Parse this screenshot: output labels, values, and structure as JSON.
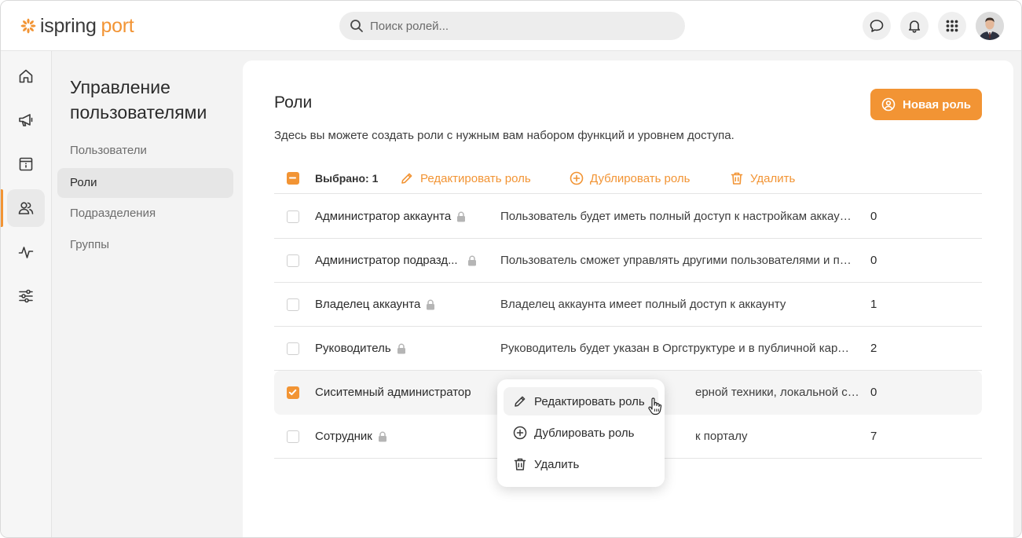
{
  "app": {
    "logo_part1": "ispring",
    "logo_part2": "port",
    "accent_color": "#f29434"
  },
  "header": {
    "search_placeholder": "Поиск ролей...",
    "icons": [
      "chat-icon",
      "bell-icon",
      "apps-grid-icon",
      "user-avatar"
    ]
  },
  "rail": {
    "items": [
      "home-icon",
      "megaphone-icon",
      "info-board-icon",
      "users-icon",
      "activity-icon",
      "settings-sliders-icon"
    ],
    "active_index": 3
  },
  "subnav": {
    "title": "Управление пользователями",
    "items": [
      {
        "label": "Пользователи"
      },
      {
        "label": "Роли"
      },
      {
        "label": "Подразделения"
      },
      {
        "label": "Группы"
      }
    ],
    "active_index": 1
  },
  "main": {
    "title": "Роли",
    "description": "Здесь вы можете создать роли с нужным вам набором функций и уровнем доступа.",
    "new_role_label": "Новая роль",
    "toolbar": {
      "selected_label": "Выбрано: 1",
      "edit_label": "Редактировать роль",
      "duplicate_label": "Дублировать роль",
      "delete_label": "Удалить"
    },
    "rows": [
      {
        "name": "Администратор аккаунта",
        "locked": true,
        "description": "Пользователь будет иметь полный доступ к настройкам аккаунта",
        "count": "0",
        "checked": false
      },
      {
        "name": "Администратор подразд...",
        "locked": true,
        "description": "Пользователь сможет управлять другими пользователями и подразделениями",
        "count": "0",
        "checked": false
      },
      {
        "name": "Владелец аккаунта",
        "locked": true,
        "description": "Владелец аккаунта имеет полный доступ к аккаунту",
        "count": "1",
        "checked": false
      },
      {
        "name": "Руководитель",
        "locked": true,
        "description": "Руководитель будет указан в Оргструктуре и в публичной карточке",
        "count": "2",
        "checked": false
      },
      {
        "name": "Сиситемный администратор",
        "locked": false,
        "description": "ерной техники, локальной сети, ...",
        "count": "0",
        "checked": true
      },
      {
        "name": "Сотрудник",
        "locked": true,
        "description": "к порталу",
        "count": "7",
        "checked": false
      }
    ],
    "context_menu": {
      "items": [
        {
          "label": "Редактировать роль",
          "icon": "pencil-icon"
        },
        {
          "label": "Дублировать роль",
          "icon": "plus-circle-icon"
        },
        {
          "label": "Удалить",
          "icon": "trash-icon"
        }
      ],
      "hover_index": 0
    }
  }
}
